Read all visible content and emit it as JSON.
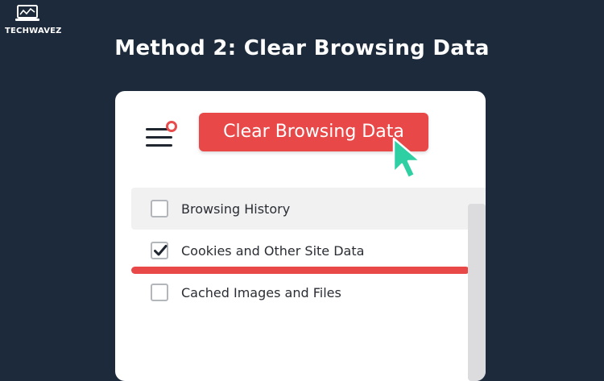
{
  "brand": {
    "name": "TECHWAVEZ"
  },
  "headline": "Method 2: Clear Browsing Data",
  "card": {
    "clear_button_label": "Clear Browsing Data",
    "options": [
      {
        "label": "Browsing History",
        "checked": false,
        "highlighted": true
      },
      {
        "label": "Cookies and Other Site Data",
        "checked": true,
        "highlighted": false
      },
      {
        "label": "Cached Images and Files",
        "checked": false,
        "highlighted": false
      }
    ]
  },
  "colors": {
    "background": "#1c2a3b",
    "accent": "#e84848",
    "cursor": "#2ecfa3"
  }
}
